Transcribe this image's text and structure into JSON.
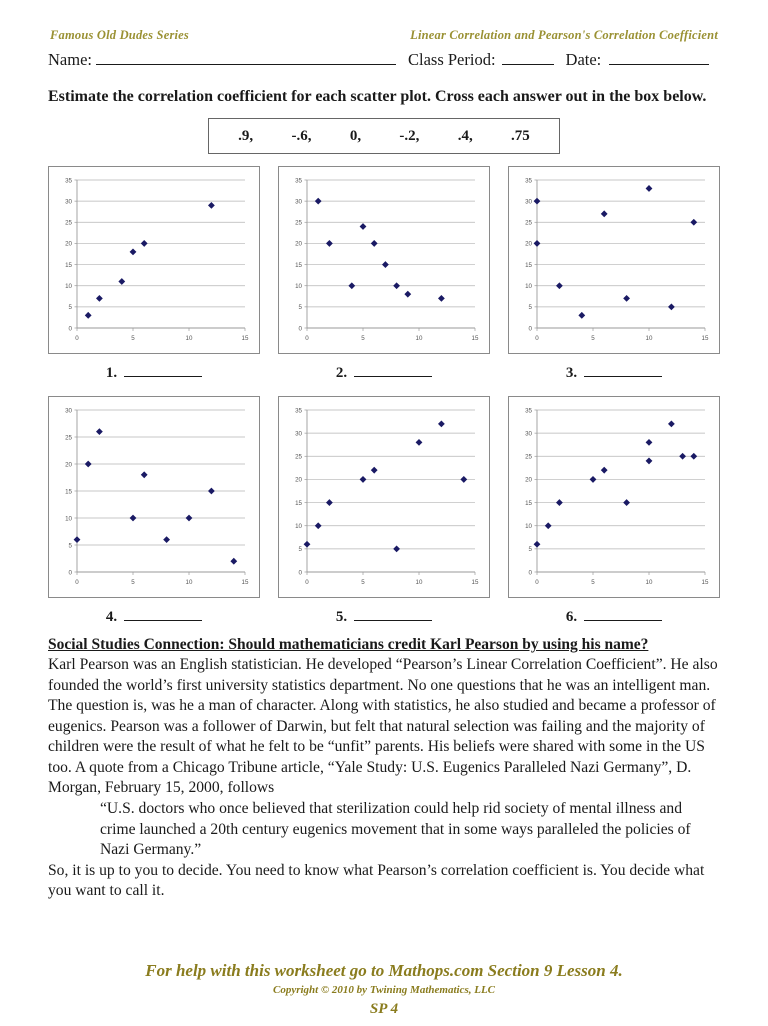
{
  "header": {
    "series_title": "Famous Old Dudes Series",
    "sheet_title": "Linear Correlation and Pearson's Correlation Coefficient",
    "name_label": "Name:",
    "class_period_label": "Class Period:",
    "date_label": "Date:",
    "accent_color": "#9a9133"
  },
  "instructions": "Estimate the correlation coefficient for each scatter plot.  Cross each answer out in the box below.",
  "answer_bank": [
    ".9,",
    "-.6,",
    "0,",
    "-.2,",
    ".4,",
    ".75"
  ],
  "answer_lines": [
    "1.",
    "2.",
    "3.",
    "4.",
    "5.",
    "6."
  ],
  "social_studies": {
    "heading": "Social Studies Connection:  Should mathematicians credit Karl Pearson by using his name?",
    "paragraph1": "Karl Pearson was an English statistician.  He developed “Pearson’s Linear Correlation Coefficient”.  He also founded the world’s first university statistics department.  No one questions that he was an intelligent man.  The question is, was he a man of character.  Along with statistics, he also studied and became a professor of eugenics.  Pearson was a follower of Darwin, but felt that natural selection was failing and the majority of children were the result of what he felt to be “unfit” parents.   His beliefs were shared with some in the US too.  A quote from a Chicago Tribune article, “Yale Study: U.S. Eugenics Paralleled Nazi Germany”, D. Morgan, February 15, 2000, follows",
    "quote": "“U.S. doctors who once believed that sterilization could help rid society of mental illness and crime launched a 20th century eugenics movement that in some ways paralleled the policies of Nazi Germany.”",
    "paragraph2": "So, it is up to you to decide.  You need to know what Pearson’s correlation coefficient is.  You decide what you want to call it."
  },
  "footer": {
    "help_text": "For help with this worksheet go to Mathops.com Section 9 Lesson 4.",
    "copyright": "Copyright © 2010 by Twining Mathematics, LLC",
    "page_label": "SP 4",
    "accent_color": "#8a7c1e"
  },
  "chart_style": {
    "marker_color": "#1a1a64",
    "grid_color": "#b4b4b4",
    "axis_color": "#9a9a9a",
    "border_color": "#8a8a8a"
  },
  "chart_data": [
    {
      "type": "scatter",
      "title": "1",
      "xlabel": "",
      "ylabel": "",
      "xlim": [
        0,
        15
      ],
      "ylim": [
        0,
        35
      ],
      "xticks": [
        0,
        5,
        10,
        15
      ],
      "yticks": [
        0,
        5,
        10,
        15,
        20,
        25,
        30,
        35
      ],
      "grid": true,
      "x": [
        1,
        2,
        4,
        5,
        6,
        12
      ],
      "y": [
        3,
        7,
        11,
        18,
        20,
        29
      ]
    },
    {
      "type": "scatter",
      "title": "2",
      "xlabel": "",
      "ylabel": "",
      "xlim": [
        0,
        15
      ],
      "ylim": [
        0,
        35
      ],
      "xticks": [
        0,
        5,
        10,
        15
      ],
      "yticks": [
        0,
        5,
        10,
        15,
        20,
        25,
        30,
        35
      ],
      "grid": true,
      "x": [
        1,
        2,
        4,
        5,
        6,
        7,
        8,
        9,
        12
      ],
      "y": [
        30,
        20,
        10,
        24,
        20,
        15,
        10,
        8,
        7
      ]
    },
    {
      "type": "scatter",
      "title": "3",
      "xlabel": "",
      "ylabel": "",
      "xlim": [
        0,
        15
      ],
      "ylim": [
        0,
        35
      ],
      "xticks": [
        0,
        5,
        10,
        15
      ],
      "yticks": [
        0,
        5,
        10,
        15,
        20,
        25,
        30,
        35
      ],
      "grid": true,
      "x": [
        0,
        0,
        2,
        4,
        6,
        8,
        10,
        12,
        14
      ],
      "y": [
        30,
        20,
        10,
        3,
        27,
        7,
        33,
        5,
        25
      ]
    },
    {
      "type": "scatter",
      "title": "4",
      "xlabel": "",
      "ylabel": "",
      "xlim": [
        0,
        15
      ],
      "ylim": [
        0,
        30
      ],
      "xticks": [
        0,
        5,
        10,
        15
      ],
      "yticks": [
        0,
        5,
        10,
        15,
        20,
        25,
        30
      ],
      "grid": true,
      "x": [
        0,
        1,
        2,
        5,
        6,
        8,
        10,
        12,
        14
      ],
      "y": [
        6,
        20,
        26,
        10,
        18,
        6,
        10,
        15,
        2
      ]
    },
    {
      "type": "scatter",
      "title": "5",
      "xlabel": "",
      "ylabel": "",
      "xlim": [
        0,
        15
      ],
      "ylim": [
        0,
        35
      ],
      "xticks": [
        0,
        5,
        10,
        15
      ],
      "yticks": [
        0,
        5,
        10,
        15,
        20,
        25,
        30,
        35
      ],
      "grid": true,
      "x": [
        0,
        1,
        2,
        5,
        6,
        8,
        10,
        12,
        14
      ],
      "y": [
        6,
        10,
        15,
        20,
        22,
        5,
        28,
        32,
        20
      ]
    },
    {
      "type": "scatter",
      "title": "6",
      "xlabel": "",
      "ylabel": "",
      "xlim": [
        0,
        15
      ],
      "ylim": [
        0,
        35
      ],
      "xticks": [
        0,
        5,
        10,
        15
      ],
      "yticks": [
        0,
        5,
        10,
        15,
        20,
        25,
        30,
        35
      ],
      "grid": true,
      "x": [
        0,
        1,
        2,
        5,
        6,
        8,
        10,
        10,
        12,
        13,
        14
      ],
      "y": [
        6,
        10,
        15,
        20,
        22,
        15,
        24,
        28,
        32,
        25,
        25
      ]
    }
  ]
}
